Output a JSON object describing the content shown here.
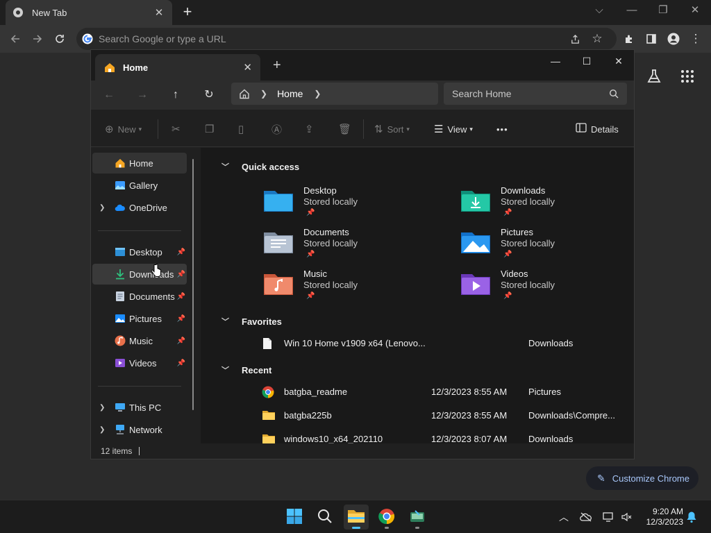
{
  "chrome": {
    "tab_title": "New Tab",
    "tab_close": "✕",
    "new_tab": "+",
    "omnibox_placeholder": "Search Google or type a URL",
    "customize_label": "Customize Chrome",
    "window_controls": {
      "dropdown": "⌵",
      "minimize": "—",
      "restore": "❐",
      "close": "✕"
    }
  },
  "explorer": {
    "tab_title": "Home",
    "tab_close": "✕",
    "new_tab": "+",
    "breadcrumb": [
      "Home"
    ],
    "search_placeholder": "Search Home",
    "commands": {
      "new": "New",
      "sort": "Sort",
      "view": "View",
      "more": "•••",
      "details": "Details"
    },
    "sidebar": {
      "nav": [
        {
          "label": "Home"
        },
        {
          "label": "Gallery"
        },
        {
          "label": "OneDrive"
        }
      ],
      "pinned": [
        {
          "label": "Desktop"
        },
        {
          "label": "Downloads"
        },
        {
          "label": "Documents"
        },
        {
          "label": "Pictures"
        },
        {
          "label": "Music"
        },
        {
          "label": "Videos"
        }
      ],
      "locations": [
        {
          "label": "This PC"
        },
        {
          "label": "Network"
        }
      ]
    },
    "sections": {
      "quick_access": "Quick access",
      "favorites": "Favorites",
      "recent": "Recent"
    },
    "quick_access": [
      {
        "name": "Desktop",
        "status": "Stored locally"
      },
      {
        "name": "Downloads",
        "status": "Stored locally"
      },
      {
        "name": "Documents",
        "status": "Stored locally"
      },
      {
        "name": "Pictures",
        "status": "Stored locally"
      },
      {
        "name": "Music",
        "status": "Stored locally"
      },
      {
        "name": "Videos",
        "status": "Stored locally"
      }
    ],
    "favorites": [
      {
        "name": "Win 10 Home v1909 x64 (Lenovo...",
        "location": "Downloads"
      }
    ],
    "recent": [
      {
        "name": "batgba_readme",
        "date": "12/3/2023 8:55 AM",
        "location": "Pictures",
        "icon": "chrome-icon"
      },
      {
        "name": "batgba225b",
        "date": "12/3/2023 8:55 AM",
        "location": "Downloads\\Compre...",
        "icon": "folder-icon"
      },
      {
        "name": "windows10_x64_202110",
        "date": "12/3/2023 8:07 AM",
        "location": "Downloads",
        "icon": "folder-icon"
      }
    ],
    "status": "12 items"
  },
  "taskbar": {
    "time": "9:20 AM",
    "date": "12/3/2023"
  },
  "colors": {
    "accent": "#4cc2ff",
    "link": "#a8c7fa"
  }
}
